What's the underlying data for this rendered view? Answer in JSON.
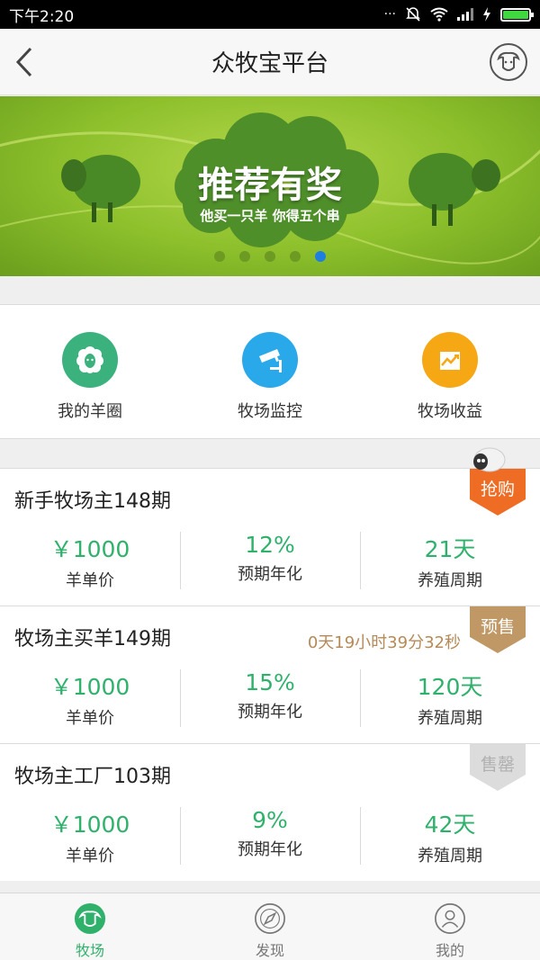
{
  "status_bar": {
    "time": "下午2:20"
  },
  "nav": {
    "title": "众牧宝平台"
  },
  "banner": {
    "title": "推荐有奖",
    "subtitle": "他买一只羊 你得五个串",
    "slide_count": 5,
    "active_slide": 5
  },
  "quick_menu": [
    {
      "label": "我的羊圈",
      "icon": "sheep-icon",
      "color": "#3bb27e"
    },
    {
      "label": "牧场监控",
      "icon": "camera-icon",
      "color": "#29a9ea"
    },
    {
      "label": "牧场收益",
      "icon": "chart-icon",
      "color": "#f5a814"
    }
  ],
  "products": [
    {
      "title": "新手牧场主148期",
      "tag": "抢购",
      "tag_color": "#ee6c24",
      "timer": "",
      "price": "￥1000",
      "price_label": "羊单价",
      "rate": "12%",
      "rate_label": "预期年化",
      "period": "21天",
      "period_label": "养殖周期"
    },
    {
      "title": "牧场主买羊149期",
      "tag": "预售",
      "tag_color": "#bf9866",
      "timer": "0天19小时39分32秒",
      "price": "￥1000",
      "price_label": "羊单价",
      "rate": "15%",
      "rate_label": "预期年化",
      "period": "120天",
      "period_label": "养殖周期"
    },
    {
      "title": "牧场主工厂103期",
      "tag": "售罄",
      "tag_color": "#dcdcdc",
      "timer": "",
      "price": "￥1000",
      "price_label": "羊单价",
      "rate": "9%",
      "rate_label": "预期年化",
      "period": "42天",
      "period_label": "养殖周期"
    }
  ],
  "tabbar": [
    {
      "label": "牧场",
      "icon": "sheep-icon",
      "active": true
    },
    {
      "label": "发现",
      "icon": "compass-icon",
      "active": false
    },
    {
      "label": "我的",
      "icon": "user-icon",
      "active": false
    }
  ],
  "colors": {
    "accent_green": "#2fb16c",
    "timer_brown": "#b68a58"
  }
}
